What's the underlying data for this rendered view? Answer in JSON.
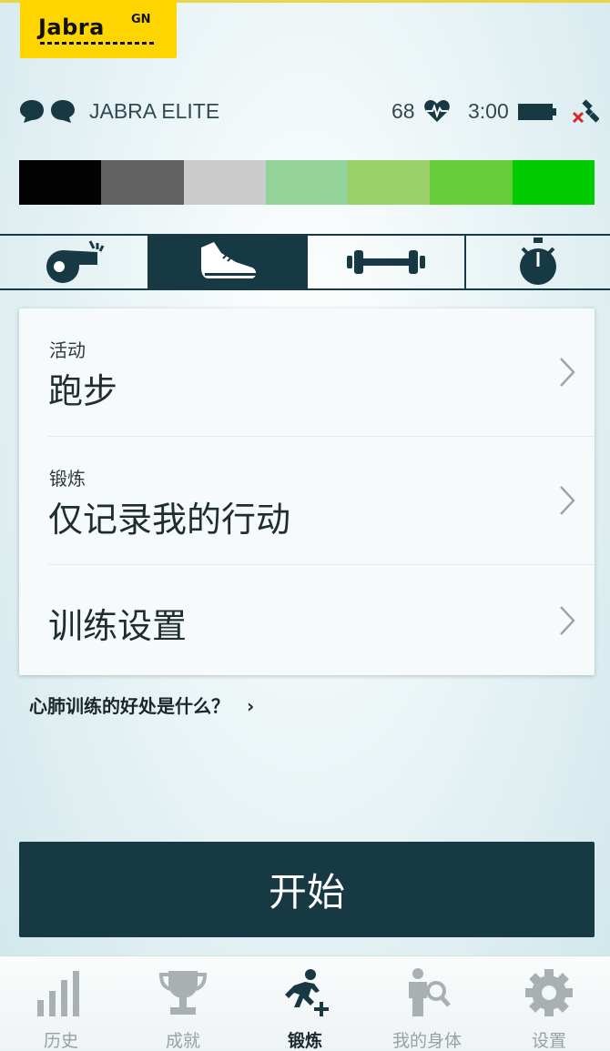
{
  "brand": {
    "logo_text": "Jabra",
    "logo_super": "GN",
    "color": "#ffd500"
  },
  "status": {
    "device_name": "JABRA ELITE",
    "heart_rate": "68",
    "time": "3:00",
    "battery_level": 1.0,
    "icons": [
      "earbud-left-icon",
      "earbud-right-icon",
      "heart-rate-icon",
      "battery-icon",
      "satellite-disconnected-icon"
    ]
  },
  "zones": {
    "colors": [
      "#030303",
      "#626262",
      "#cccccc",
      "#94d39a",
      "#99d168",
      "#66cc3a",
      "#00cc00"
    ]
  },
  "workout_tabs": [
    {
      "name": "whistle-icon",
      "active": false
    },
    {
      "name": "running-shoe-icon",
      "active": true
    },
    {
      "name": "dumbbell-icon",
      "active": false
    },
    {
      "name": "stopwatch-icon",
      "active": false
    }
  ],
  "settings": {
    "activity": {
      "label": "活动",
      "value": "跑步"
    },
    "workout": {
      "label": "锻炼",
      "value": "仅记录我的行动"
    },
    "training_settings": {
      "value": "训练设置"
    }
  },
  "benefit_link": {
    "text": "心肺训练的好处是什么？",
    "chevron": "›"
  },
  "start_button": {
    "label": "开始",
    "color": "#163943"
  },
  "bottom_nav": [
    {
      "label": "历史",
      "icon": "bar-chart-icon",
      "active": false
    },
    {
      "label": "成就",
      "icon": "trophy-icon",
      "active": false
    },
    {
      "label": "锻炼",
      "icon": "runner-plus-icon",
      "active": true
    },
    {
      "label": "我的身体",
      "icon": "body-search-icon",
      "active": false
    },
    {
      "label": "设置",
      "icon": "gear-icon",
      "active": false
    }
  ]
}
